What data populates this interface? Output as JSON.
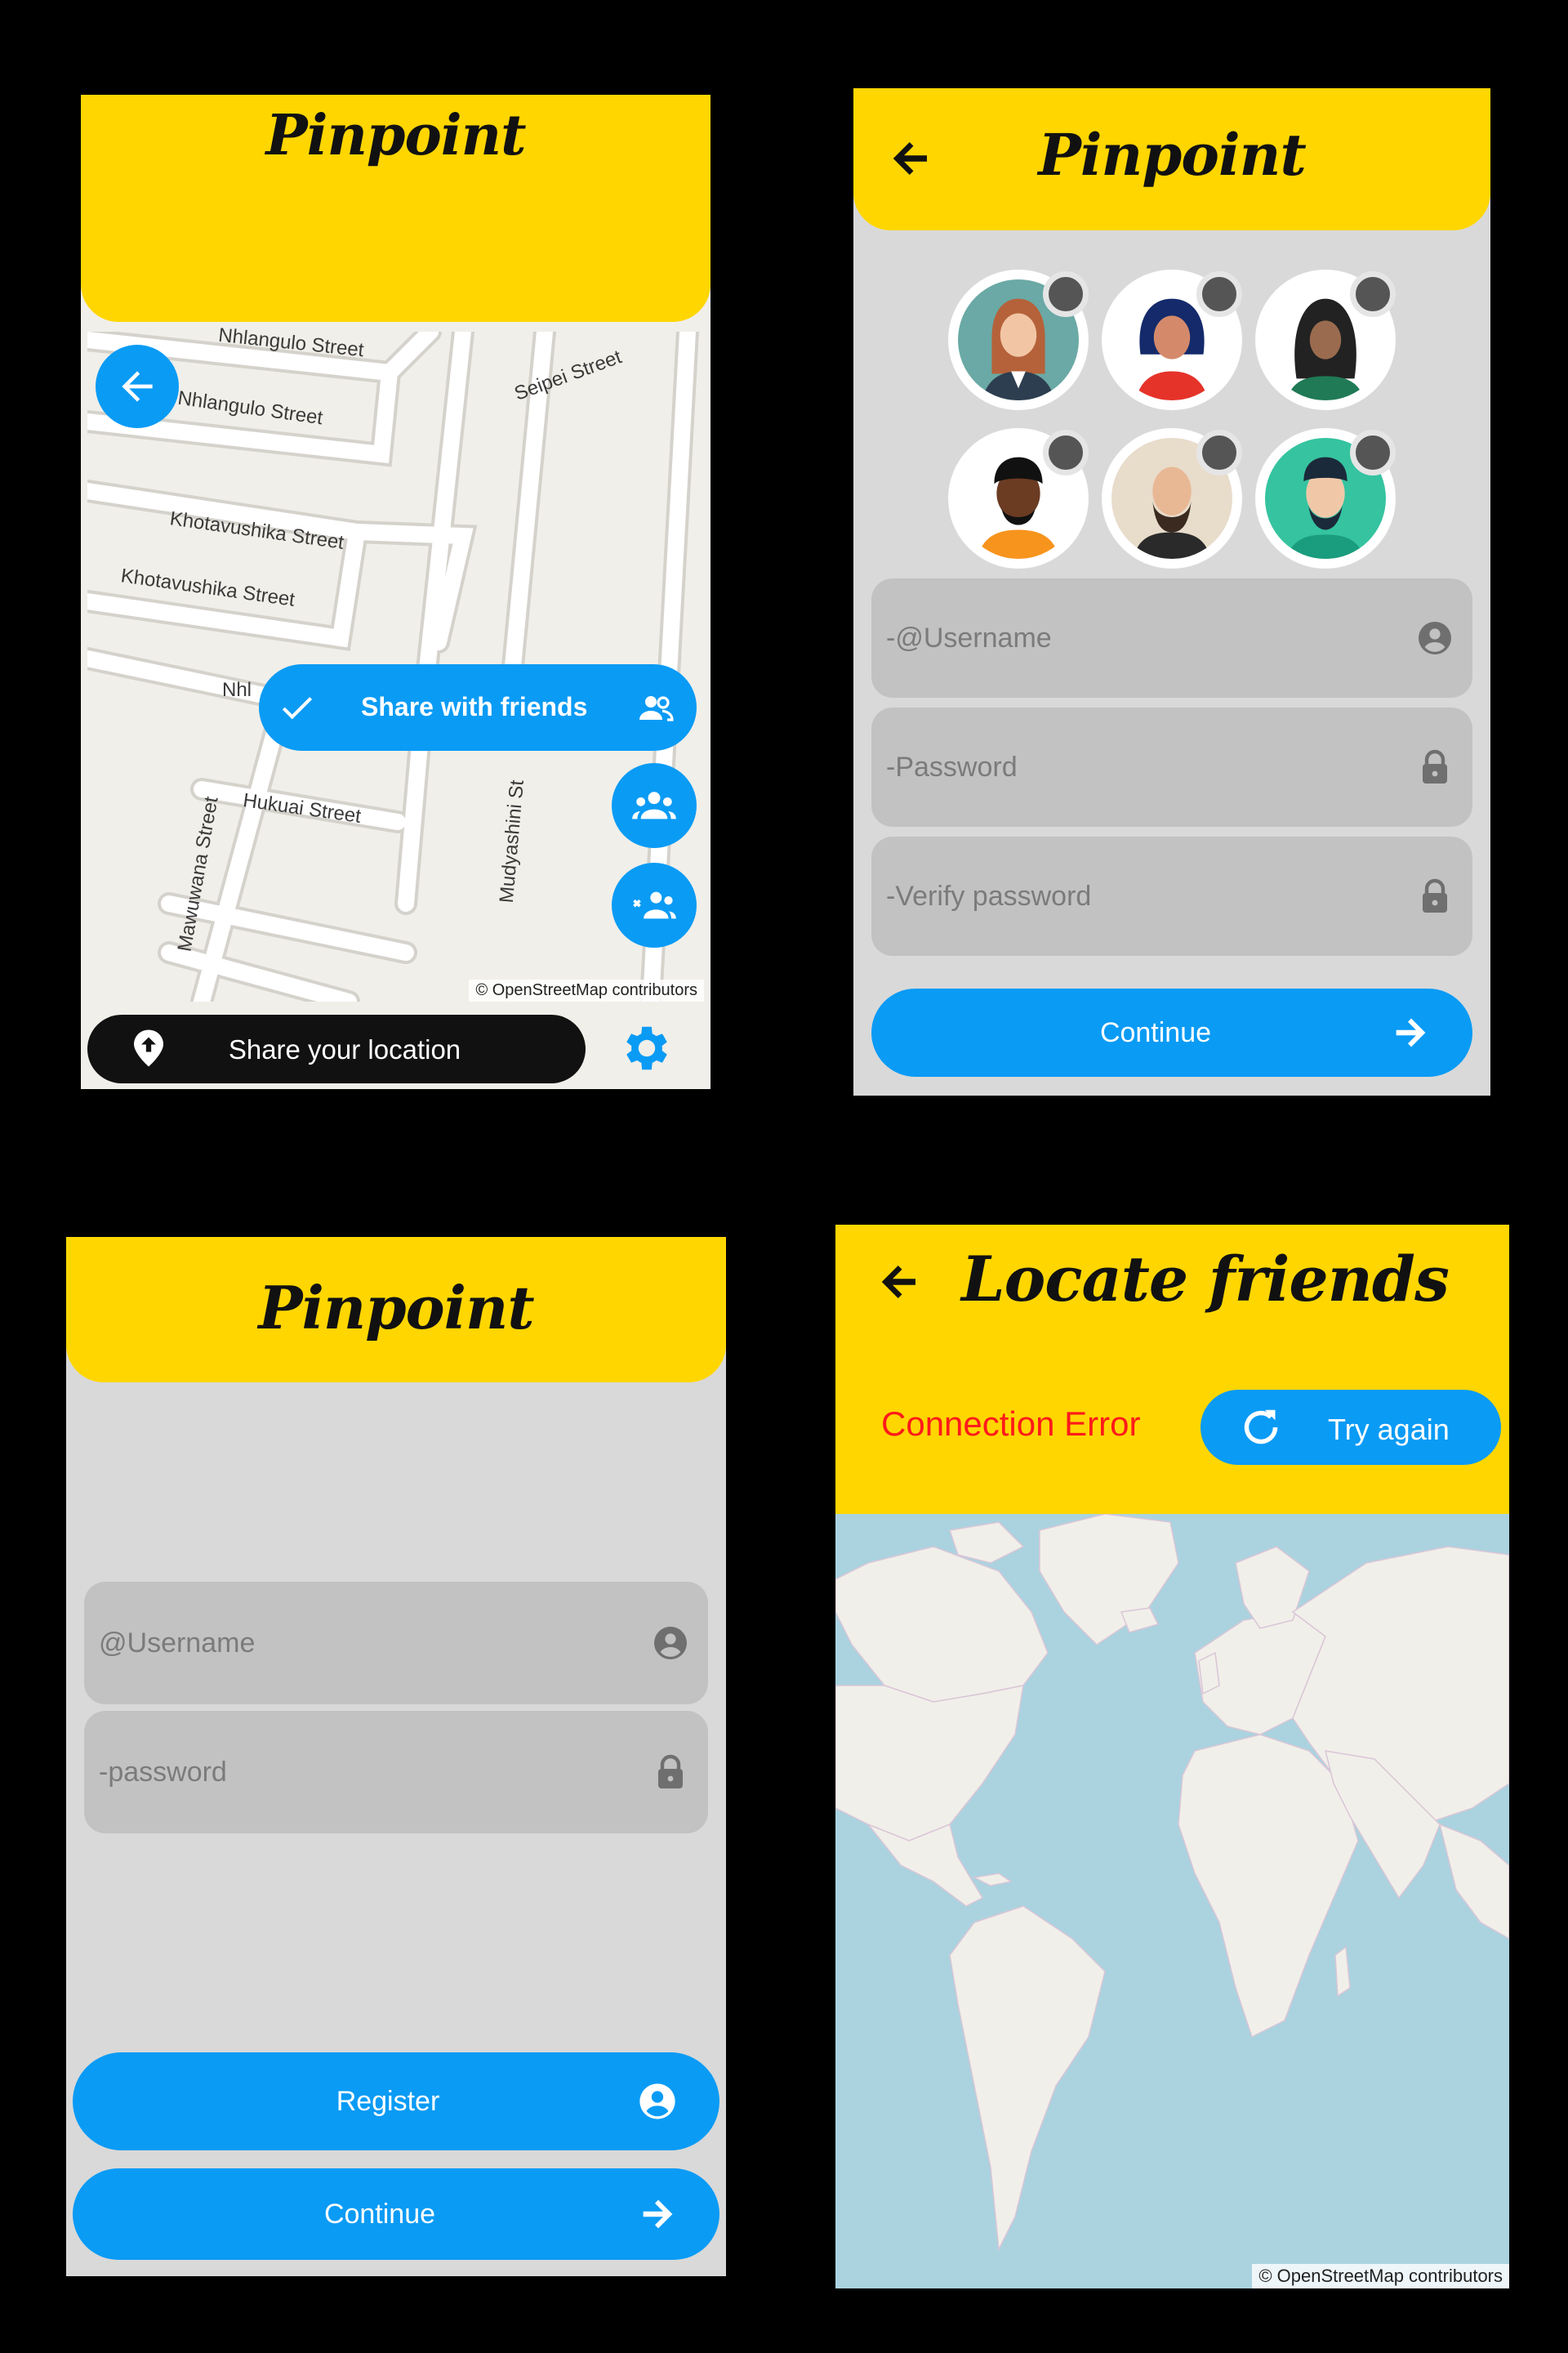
{
  "screens": {
    "map_share": {
      "brand": "Pinpoint",
      "streets": [
        "Nhlangulo Street",
        "Nhlangulo Street",
        "Seipei Street",
        "Khotavushika Street",
        "Khotavushika Street",
        "Nhl",
        "Hukuai Street",
        "Mudyashini St",
        "Mawuwana Street"
      ],
      "share_friends_label": "Share with friends",
      "attribution": "© OpenStreetMap contributors",
      "share_location_label": "Share your location"
    },
    "register": {
      "brand": "Pinpoint",
      "username_placeholder": "-@Username",
      "password_placeholder": "-Password",
      "verify_placeholder": "-Verify password",
      "continue_label": "Continue"
    },
    "login": {
      "brand": "Pinpoint",
      "username_placeholder": "@Username",
      "password_placeholder": "-password",
      "register_label": "Register",
      "continue_label": "Continue"
    },
    "locate": {
      "title": "Locate friends",
      "error_text": "Connection Error",
      "try_again_label": "Try again",
      "attribution": "© OpenStreetMap contributors"
    }
  },
  "colors": {
    "header_yellow": "#ffd600",
    "accent_blue": "#0a9bf5",
    "error_red": "#ff1a1a",
    "field_gray": "#c2c2c2",
    "screen_gray": "#d9d9d9",
    "map_land": "#f1efe9",
    "map_water": "#aad3df"
  },
  "icons": [
    "arrow-left-icon",
    "check-icon",
    "people-icon",
    "group-icon",
    "group-remove-icon",
    "location-pin-icon",
    "gear-icon",
    "account-circle-icon",
    "lock-icon",
    "arrow-right-icon",
    "refresh-icon"
  ]
}
